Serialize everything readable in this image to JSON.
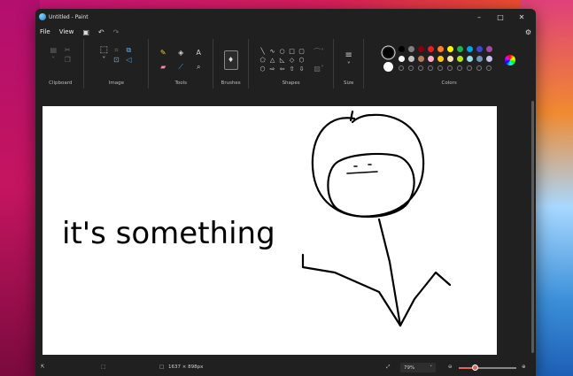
{
  "window": {
    "title": "Untitled - Paint",
    "minimize_glyph": "–",
    "maximize_glyph": "□",
    "close_glyph": "✕"
  },
  "menu": {
    "file": "File",
    "view": "View"
  },
  "ribbon": {
    "groups": {
      "clipboard": "Clipboard",
      "image": "Image",
      "tools": "Tools",
      "brushes": "Brushes",
      "shapes": "Shapes",
      "size": "Size",
      "colors": "Colors"
    }
  },
  "colors": {
    "primary": "#000000",
    "secondary": "#ffffff",
    "palette_row1": [
      "#000000",
      "#7f7f7f",
      "#880015",
      "#ed1c24",
      "#ff7f27",
      "#fff200",
      "#22b14c",
      "#00a2e8",
      "#3f48cc",
      "#a349a4"
    ],
    "palette_row2": [
      "#ffffff",
      "#c3c3c3",
      "#b97a57",
      "#ffaec9",
      "#ffc90e",
      "#efe4b0",
      "#b5e61d",
      "#99d9ea",
      "#7092be",
      "#c8bfe7"
    ]
  },
  "canvas": {
    "handwritten_text": "it's something"
  },
  "status": {
    "canvas_size": "1637 × 898px",
    "zoom": "79%",
    "zoom_level": 0.29
  }
}
